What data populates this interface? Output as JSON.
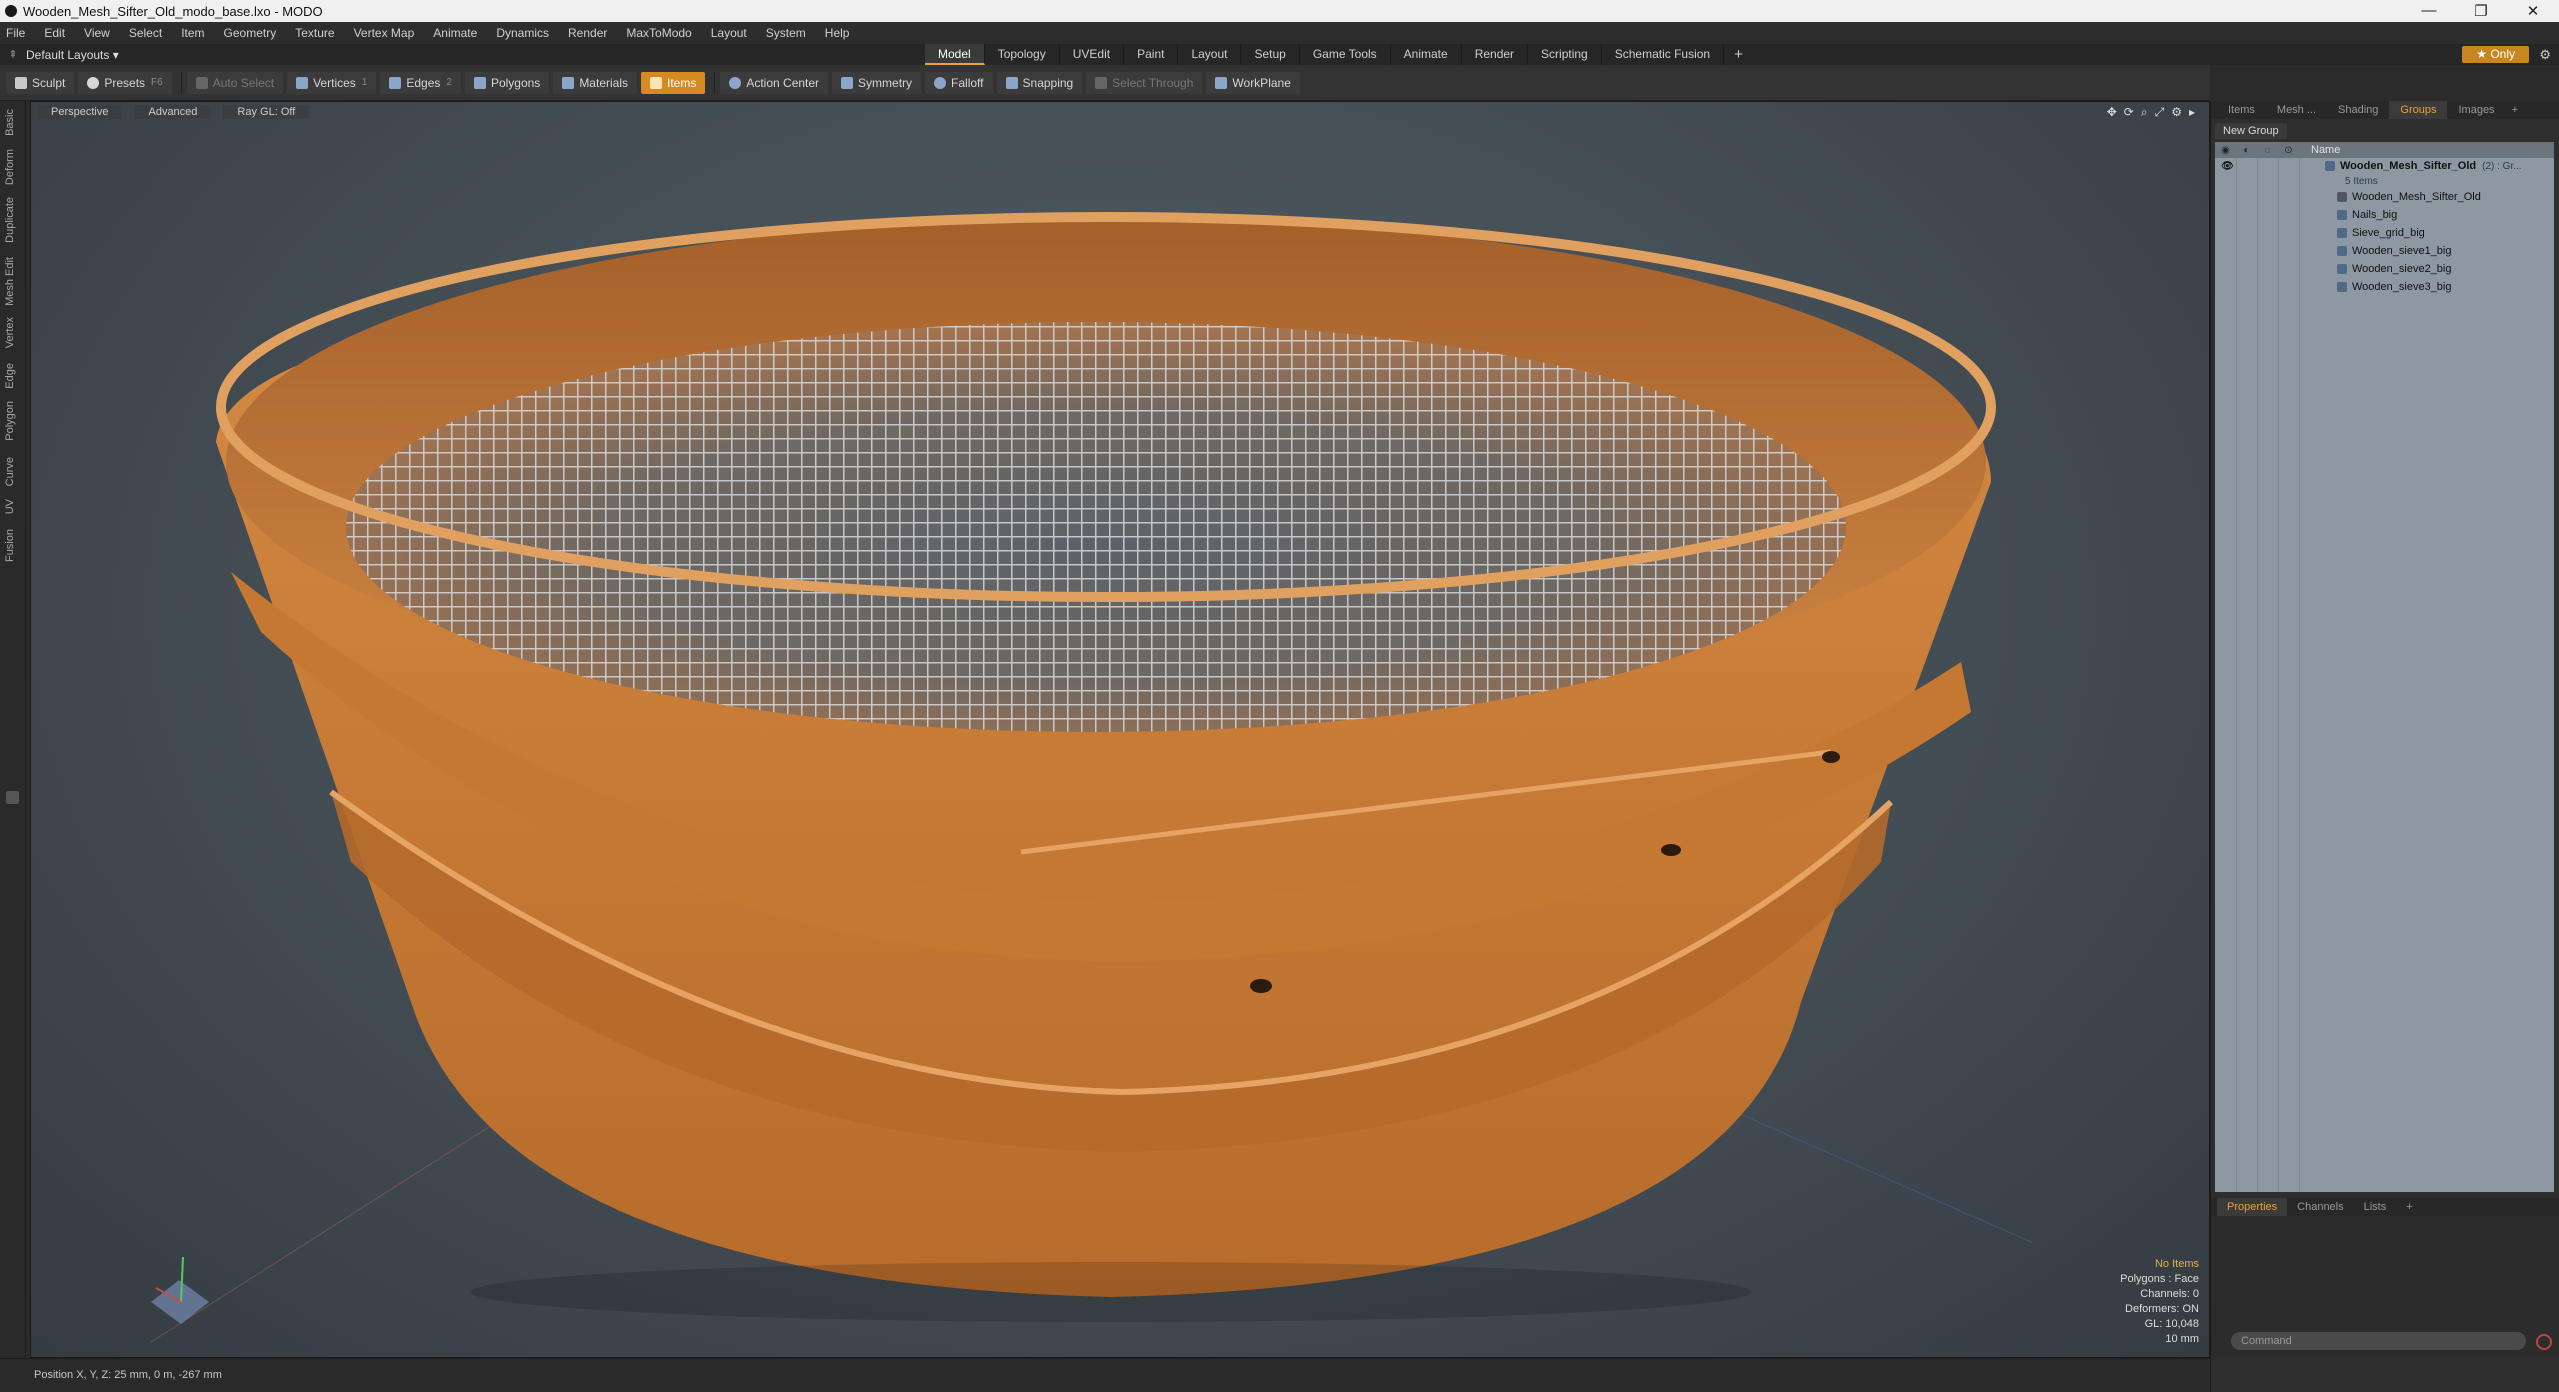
{
  "window": {
    "title": "Wooden_Mesh_Sifter_Old_modo_base.lxo - MODO",
    "controls": [
      "—",
      "❐",
      "✕"
    ]
  },
  "menu": [
    "File",
    "Edit",
    "View",
    "Select",
    "Item",
    "Geometry",
    "Texture",
    "Vertex Map",
    "Animate",
    "Dynamics",
    "Render",
    "MaxToModo",
    "Layout",
    "System",
    "Help"
  ],
  "layouts": {
    "label": "Default Layouts ▾"
  },
  "tabs": [
    "Model",
    "Topology",
    "UVEdit",
    "Paint",
    "Layout",
    "Setup",
    "Game Tools",
    "Animate",
    "Render",
    "Scripting",
    "Schematic Fusion"
  ],
  "active_tab": "Model",
  "only_button": "★  Only",
  "toolbar": {
    "sculpt": "Sculpt",
    "presets": "Presets",
    "presets_key": "F6",
    "auto_select": "Auto Select",
    "vertices": "Vertices",
    "vertices_key": "1",
    "edges": "Edges",
    "edges_key": "2",
    "polygons": "Polygons",
    "materials": "Materials",
    "items": "Items",
    "action_center": "Action Center",
    "symmetry": "Symmetry",
    "falloff": "Falloff",
    "snapping": "Snapping",
    "select_through": "Select Through",
    "workplane": "WorkPlane"
  },
  "left_strip": [
    "Basic",
    "Deform",
    "Duplicate",
    "Mesh Edit",
    "Vertex",
    "Edge",
    "Polygon",
    "Curve",
    "UV",
    "Fusion"
  ],
  "viewport": {
    "view": "Perspective",
    "shading": "Advanced",
    "raygl": "Ray GL: Off",
    "icons": [
      "move-view-icon",
      "rotate-view-icon",
      "zoom-view-icon",
      "fit-view-icon",
      "viewport-settings-icon",
      "expand-icon"
    ],
    "stats": {
      "no_items": "No Items",
      "polygons": "Polygons : Face",
      "channels": "Channels: 0",
      "deformers": "Deformers: ON",
      "gl": "GL: 10,048",
      "scale": "10 mm"
    }
  },
  "status": {
    "position": "Position X, Y, Z:  25 mm, 0 m, -267 mm"
  },
  "right_panel": {
    "tabs": [
      "Items",
      "Mesh ...",
      "Shading",
      "Groups",
      "Images"
    ],
    "active_tab": "Groups",
    "new_group": "New Group",
    "header_name": "Name",
    "root": {
      "name": "Wooden_Mesh_Sifter_Old",
      "suffix": "(2) : Gr...",
      "sub": "5 Items"
    },
    "items": [
      "Wooden_Mesh_Sifter_Old",
      "Nails_big",
      "Sieve_grid_big",
      "Wooden_sieve1_big",
      "Wooden_sieve2_big",
      "Wooden_sieve3_big"
    ],
    "prop_tabs": [
      "Properties",
      "Channels",
      "Lists"
    ],
    "prop_active": "Properties",
    "command_placeholder": "Command"
  },
  "colors": {
    "accent": "#e8a23a",
    "items_active": "#d88a22",
    "wood": "#c27a36",
    "viewport_bg": "#4a535a"
  }
}
